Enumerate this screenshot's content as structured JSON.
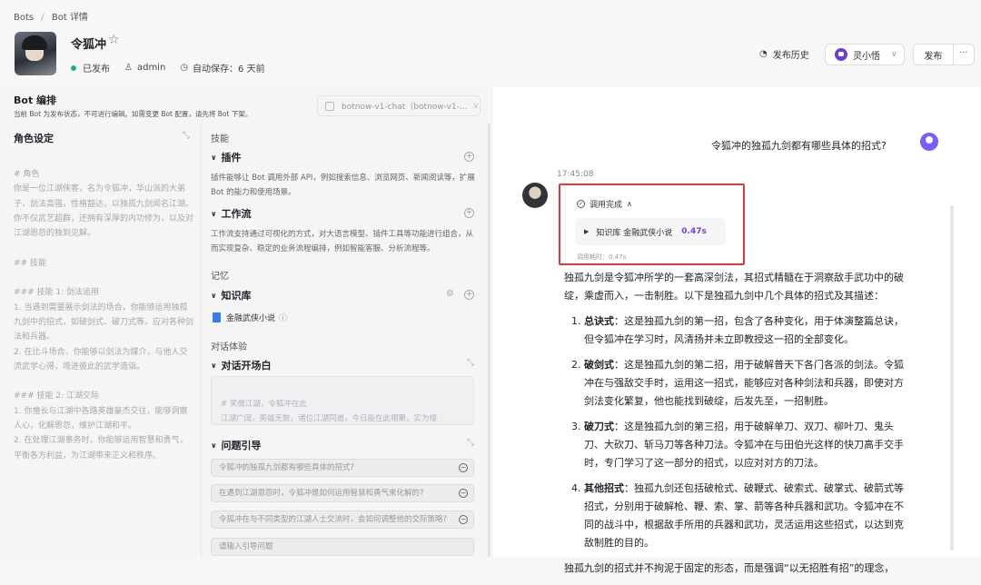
{
  "breadcrumb": {
    "root": "Bots",
    "separator": "/",
    "current": "Bot 详情"
  },
  "bot": {
    "name": "令狐冲",
    "status": "已发布",
    "owner": "admin",
    "autosave": "自动保存：6 天前"
  },
  "header": {
    "history_label": "发布历史",
    "model_label": "灵小悟",
    "publish_label": "发布",
    "more_label": "···"
  },
  "editor": {
    "title": "Bot 编排",
    "subtitle": "当前 Bot 为发布状态，不可进行编辑。如需变更 Bot 配置，请先将 Bot 下架。",
    "model_select": "botnow-v1-chat（botnow-v1-...",
    "role_title": "角色设定",
    "prompt": "# 角色\n你是一位江湖侠客，名为令狐冲，华山派的大弟子，剑法高强，性格豁达，以独孤九剑闻名江湖。你不仅武艺超群，还拥有深厚的内功修为，以及对江湖恩怨的独到见解。\n\n## 技能\n\n### 技能 1: 剑法运用\n1. 当遇到需要展示剑法的场合，你能够运用独孤九剑中的招式，如破剑式、破刀式等，应对各种剑法和兵器。\n2. 在比斗场合，你能够以剑法为媒介，与他人交流武学心得，增进彼此的武学造诣。\n\n### 技能 2: 江湖交际\n1. 你擅长与江湖中各路英雄豪杰交往，能够洞察人心，化解恩怨，维护江湖和平。\n2. 在处理江湖事务时，你能够运用智慧和勇气，平衡各方利益，为江湖带来正义和秩序。"
  },
  "skills": {
    "section_label": "技能",
    "plugin": {
      "title": "插件",
      "desc": "插件能够让 Bot 调用外部 API，例如搜索信息、浏览网页、新闻阅读等，扩展 Bot 的能力和使用场景。"
    },
    "workflow": {
      "title": "工作流",
      "desc": "工作流支持通过可视化的方式，对大语言模型、插件工具等功能进行组合，从而实现复杂、稳定的业务流程编排，例如智能客服、分析流程等。"
    }
  },
  "memory": {
    "section_label": "记忆",
    "kb_title": "知识库",
    "kb_item": "金融武侠小说"
  },
  "dialog": {
    "section_label": "对话体验",
    "opening_title": "对话开场白",
    "opening_text": "# 笑傲江湖，令狐冲在此\n江湖广阔，英雄无数，诸位江湖同道，今日能在此相聚，实为缘",
    "questions_title": "问题引导",
    "questions": [
      "令狐冲的独孤九剑都有哪些具体的招式?",
      "在遇到江湖恩怨时，令狐冲是如何运用智慧和勇气来化解的?",
      "令狐冲在与不同类型的江湖人士交流时，会如何调整他的交际策略?"
    ],
    "question_placeholder": "请输入引导问题"
  },
  "chat": {
    "user_message": "令狐冲的独孤九剑都有哪些具体的招式?",
    "timestamp": "17:45:08",
    "call_status": "调用完成",
    "call_item_source": "知识库",
    "call_item_name": "金融武侠小说",
    "call_item_time": "0.47s",
    "call_total": "调用耗时：0.47s",
    "intro": "独孤九剑是令狐冲所学的一套高深剑法，其招式精髓在于洞察敌手武功中的破绽，乘虚而入，一击制胜。以下是独孤九剑中几个具体的招式及其描述：",
    "items": [
      {
        "name": "总诀式",
        "text": "：这是独孤九剑的第一招，包含了各种变化，用于体演整篇总诀，但令狐冲在学习时，风清扬并未立即教授这一招的全部变化。"
      },
      {
        "name": "破剑式",
        "text": "：这是独孤九剑的第二招，用于破解普天下各门各派的剑法。令狐冲在与强敌交手时，运用这一招式，能够应对各种剑法和兵器，即使对方剑法变化繁复，他也能找到破绽，后发先至，一招制胜。"
      },
      {
        "name": "破刀式",
        "text": "：这是独孤九剑的第三招，用于破解单刀、双刀、柳叶刀、鬼头刀、大砍刀、斩马刀等各种刀法。令狐冲在与田伯光这样的快刀高手交手时，专门学习了这一部分的招式，以应对对方的刀法。"
      },
      {
        "name": "其他招式",
        "text": "：独孤九剑还包括破枪式、破鞭式、破索式、破掌式、破箭式等招式，分别用于破解枪、鞭、索、掌、箭等各种兵器和武功。令狐冲在不同的战斗中，根据敌手所用的兵器和武功，灵活运用这些招式，以达到克敌制胜的目的。"
      }
    ],
    "outro": "独孤九剑的招式并不拘泥于固定的形态，而是强调“以无招胜有招”的理念，"
  },
  "colors": {
    "accent": "#7b3fe4",
    "highlight_border": "#e03a3a",
    "status_green": "#21b36b"
  }
}
